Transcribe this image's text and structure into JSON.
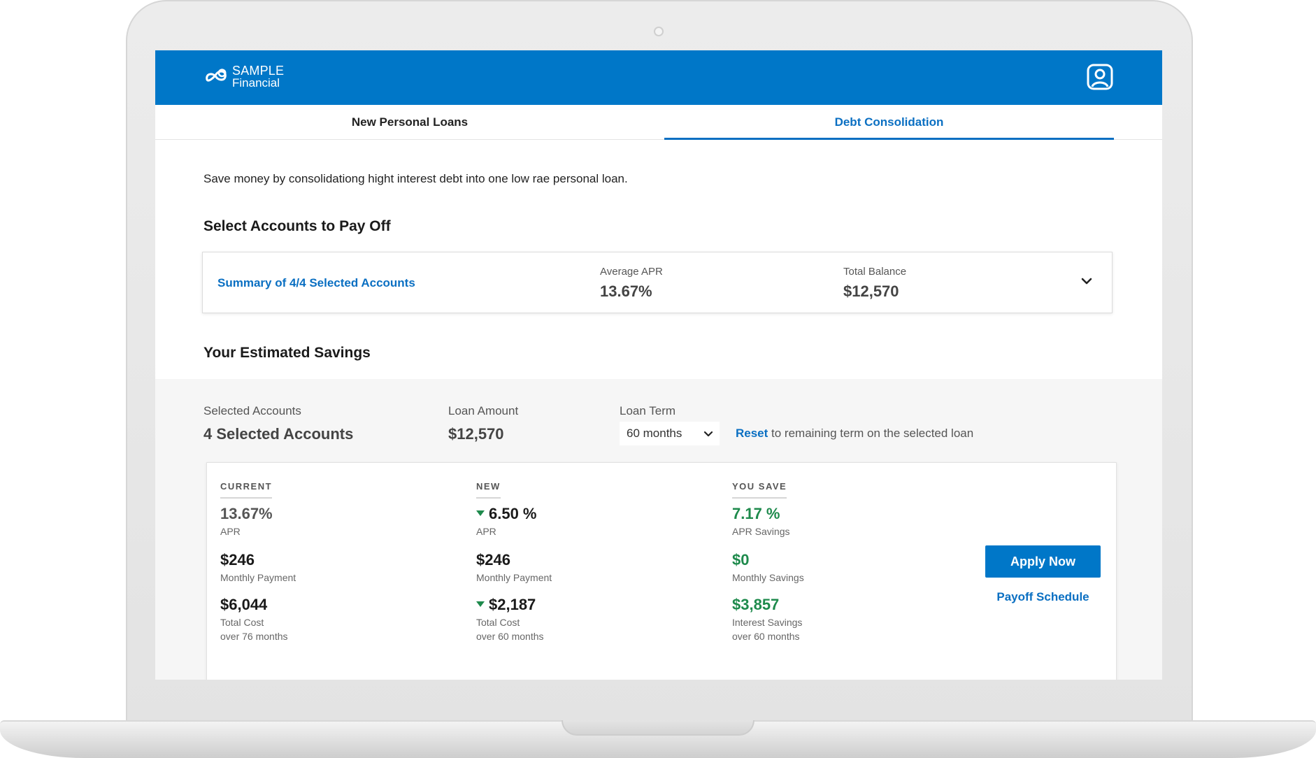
{
  "brand": {
    "line1": "SAMPLE",
    "line2": "Financial"
  },
  "tabs": [
    {
      "label": "New Personal Loans",
      "active": false
    },
    {
      "label": "Debt Consolidation",
      "active": true
    }
  ],
  "intro": "Save money by consolidationg hight interest debt into one low rae personal loan.",
  "select_accounts": {
    "heading": "Select Accounts to Pay Off",
    "summary_link": "Summary of 4/4 Selected Accounts",
    "avg_apr_label": "Average APR",
    "avg_apr_value": "13.67%",
    "total_balance_label": "Total Balance",
    "total_balance_value": "$12,570"
  },
  "savings": {
    "heading": "Your Estimated Savings",
    "selected_label": "Selected Accounts",
    "selected_value": "4 Selected Accounts",
    "loan_amount_label": "Loan Amount",
    "loan_amount_value": "$12,570",
    "loan_term_label": "Loan Term",
    "loan_term_value": "60 months",
    "reset_link": "Reset",
    "reset_text": " to remaining term on the selected loan"
  },
  "compare": {
    "current": {
      "heading": "CURRENT",
      "apr": "13.67%",
      "apr_label": "APR",
      "payment": "$246",
      "payment_label": "Monthly Payment",
      "cost": "$6,044",
      "cost_label": "Total Cost",
      "cost_sub": "over 76 months"
    },
    "new": {
      "heading": "NEW",
      "apr": "6.50 %",
      "apr_label": "APR",
      "payment": "$246",
      "payment_label": "Monthly Payment",
      "cost": "$2,187",
      "cost_label": "Total Cost",
      "cost_sub": "over 60 months"
    },
    "save": {
      "heading": "YOU SAVE",
      "apr": "7.17 %",
      "apr_label": "APR Savings",
      "payment": "$0",
      "payment_label": "Monthly Savings",
      "cost": "$3,857",
      "cost_label": "Interest Savings",
      "cost_sub": "over 60 months"
    },
    "apply_label": "Apply Now",
    "payoff_label": "Payoff Schedule"
  },
  "colors": {
    "brand_blue": "#0077c8",
    "link_blue": "#0a6fc2",
    "savings_green": "#1e8a4c"
  },
  "icons": {
    "profile": "user-profile-icon",
    "logo": "infinity-logo-icon",
    "chevron": "chevron-down-icon",
    "decrease": "triangle-down-icon"
  }
}
